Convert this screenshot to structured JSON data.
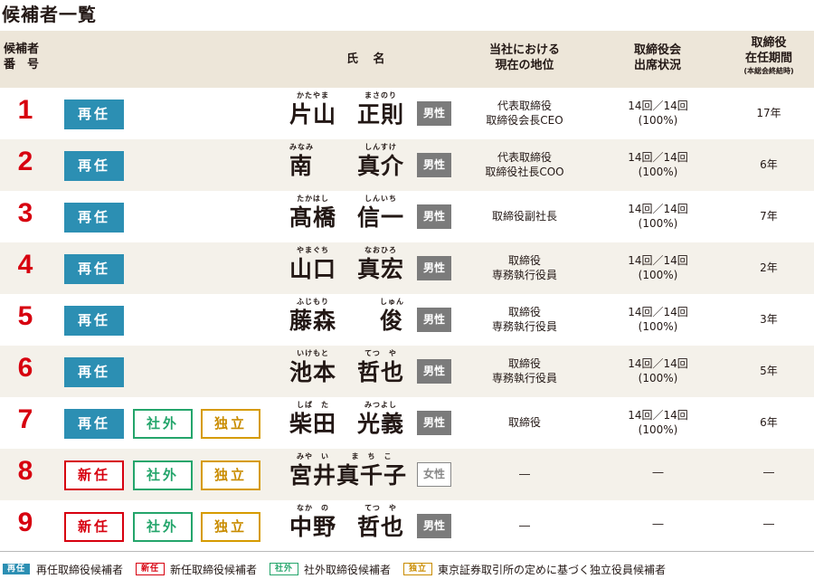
{
  "title": "候補者一覧",
  "header": {
    "num_line1": "候補者",
    "num_line2": "番　号",
    "name": "氏 名",
    "position_line1": "当社における",
    "position_line2": "現在の地位",
    "attendance_line1": "取締役会",
    "attendance_line2": "出席状況",
    "tenure_line1": "取締役",
    "tenure_line2": "在任期間",
    "tenure_note": "(本総会終結時)"
  },
  "badge_labels": {
    "reappointment": "再任",
    "new": "新任",
    "outside": "社外",
    "independent": "独立"
  },
  "sex_labels": {
    "male": "男性",
    "female": "女性"
  },
  "candidates": [
    {
      "num": "1",
      "family_ruby": "かたやま",
      "family": "片山",
      "given_ruby": "まさのり",
      "given": "正則",
      "pos1": "代表取締役",
      "pos2": "取締役会長CEO",
      "att1": "14回／14回",
      "att2": "(100%)",
      "tenure": "17年"
    },
    {
      "num": "2",
      "family_ruby": "みなみ",
      "family": "南",
      "given_ruby": "しんすけ",
      "given": "真介",
      "pos1": "代表取締役",
      "pos2": "取締役社長COO",
      "att1": "14回／14回",
      "att2": "(100%)",
      "tenure": "6年"
    },
    {
      "num": "3",
      "family_ruby": "たかはし",
      "family": "髙橋",
      "given_ruby": "しんいち",
      "given": "信一",
      "pos1": "取締役副社長",
      "pos2": "",
      "att1": "14回／14回",
      "att2": "(100%)",
      "tenure": "7年"
    },
    {
      "num": "4",
      "family_ruby": "やまぐち",
      "family": "山口",
      "given_ruby": "なおひろ",
      "given": "真宏",
      "pos1": "取締役",
      "pos2": "専務執行役員",
      "att1": "14回／14回",
      "att2": "(100%)",
      "tenure": "2年"
    },
    {
      "num": "5",
      "family_ruby": "ふじもり",
      "family": "藤森",
      "given_ruby": "しゅん",
      "given": "俊",
      "pos1": "取締役",
      "pos2": "専務執行役員",
      "att1": "14回／14回",
      "att2": "(100%)",
      "tenure": "3年"
    },
    {
      "num": "6",
      "family_ruby": "いけもと",
      "family": "池本",
      "given_ruby": "てつ　や",
      "given": "哲也",
      "pos1": "取締役",
      "pos2": "専務執行役員",
      "att1": "14回／14回",
      "att2": "(100%)",
      "tenure": "5年"
    },
    {
      "num": "7",
      "family_ruby": "しば　た",
      "family": "柴田",
      "given_ruby": "みつよし",
      "given": "光義",
      "pos1": "取締役",
      "pos2": "",
      "att1": "14回／14回",
      "att2": "(100%)",
      "tenure": "6年"
    },
    {
      "num": "8",
      "family_ruby": "みや　い",
      "family": "宮井",
      "given_ruby": "ま　ち　こ",
      "given": "真千子",
      "pos1": "―",
      "pos2": "",
      "att1": "―",
      "att2": "",
      "tenure": "―"
    },
    {
      "num": "9",
      "family_ruby": "なか　の",
      "family": "中野",
      "given_ruby": "てつ　や",
      "given": "哲也",
      "pos1": "―",
      "pos2": "",
      "att1": "―",
      "att2": "",
      "tenure": "―"
    }
  ],
  "legend": {
    "reappointment_badge": "再任",
    "reappointment_text": "再任取締役候補者",
    "new_badge": "新任",
    "new_text": "新任取締役候補者",
    "outside_badge": "社外",
    "outside_text": "社外取締役候補者",
    "independent_badge": "独立",
    "independent_text": "東京証券取引所の定めに基づく独立役員候補者"
  },
  "colors": {
    "number_red": "#d7000f",
    "reappointment_blue": "#2c8fb3",
    "new_red": "#d7000f",
    "outside_green": "#24a56b",
    "independent_gold": "#d69b00",
    "header_bg": "#ede6d9",
    "alt_row_bg": "#f4f1ea",
    "male_gray": "#7b7b7b"
  }
}
